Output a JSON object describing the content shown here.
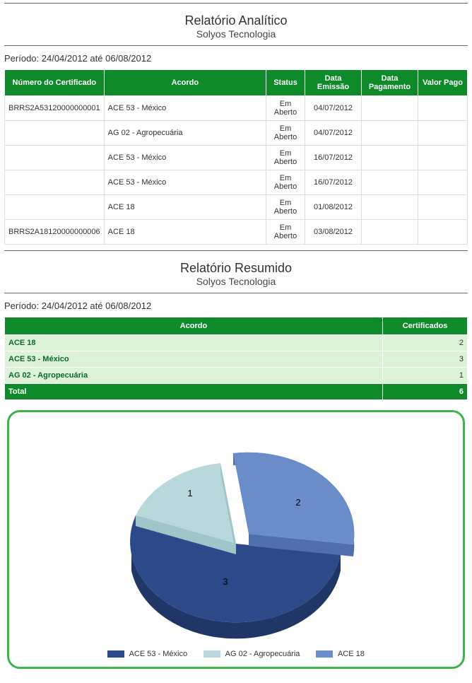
{
  "report1": {
    "title": "Relatório Analítico",
    "subtitle": "Solyos Tecnologia",
    "period_label": "Período: 24/04/2012 até 06/08/2012",
    "headers": {
      "cert_num": "Número do Certificado",
      "acordo": "Acordo",
      "status": "Status",
      "emissao": "Data Emissão",
      "pagamento": "Data Pagamento",
      "valor_pago": "Valor Pago"
    },
    "rows": [
      {
        "cert": "BRRS2A53120000000001",
        "acordo": "ACE 53 - México",
        "status": "Em Aberto",
        "emissao": "04/07/2012",
        "pagamento": "",
        "valor": ""
      },
      {
        "cert": "",
        "acordo": "AG 02 - Agropecuária",
        "status": "Em Aberto",
        "emissao": "04/07/2012",
        "pagamento": "",
        "valor": ""
      },
      {
        "cert": "",
        "acordo": "ACE 53 - México",
        "status": "Em Aberto",
        "emissao": "16/07/2012",
        "pagamento": "",
        "valor": ""
      },
      {
        "cert": "",
        "acordo": "ACE 53 - México",
        "status": "Em Aberto",
        "emissao": "16/07/2012",
        "pagamento": "",
        "valor": ""
      },
      {
        "cert": "",
        "acordo": "ACE 18",
        "status": "Em Aberto",
        "emissao": "01/08/2012",
        "pagamento": "",
        "valor": ""
      },
      {
        "cert": "BRRS2A18120000000006",
        "acordo": "ACE 18",
        "status": "Em Aberto",
        "emissao": "03/08/2012",
        "pagamento": "",
        "valor": ""
      }
    ]
  },
  "report2": {
    "title": "Relatório Resumido",
    "subtitle": "Solyos Tecnologia",
    "period_label": "Período: 24/04/2012 até 06/08/2012",
    "headers": {
      "acordo": "Acordo",
      "certificados": "Certificados"
    },
    "rows": [
      {
        "acordo": "ACE 18",
        "count": "2"
      },
      {
        "acordo": "ACE 53 - México",
        "count": "3"
      },
      {
        "acordo": "AG 02 - Agropecuária",
        "count": "1"
      }
    ],
    "total_label": "Total",
    "total_value": "6"
  },
  "chart_data": {
    "type": "pie",
    "title": "",
    "categories": [
      "ACE 53 - México",
      "AG 02 - Agropecuária",
      "ACE 18"
    ],
    "values": [
      3,
      1,
      2
    ],
    "colors": {
      "ACE 53 - México": "#2c4a8a",
      "AG 02 - Agropecuária": "#b9d8db",
      "ACE 18": "#6a8dc9"
    },
    "legend_position": "bottom"
  },
  "legend": {
    "items": [
      {
        "label": "ACE 53 - México",
        "color": "#2c4a8a"
      },
      {
        "label": "AG 02 - Agropecuária",
        "color": "#b9d8db"
      },
      {
        "label": "ACE 18",
        "color": "#6a8dc9"
      }
    ]
  }
}
